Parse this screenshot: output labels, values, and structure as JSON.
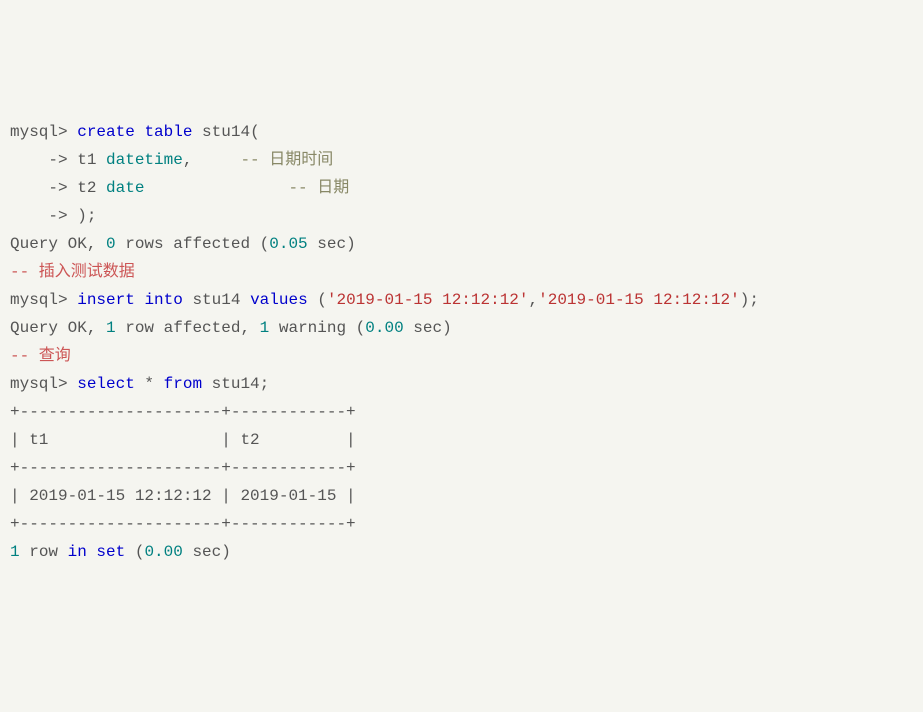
{
  "lines": {
    "l1_prompt": "mysql> ",
    "l1_kw1": "create",
    "l1_kw2": "table",
    "l1_id": " stu14(",
    "l2_prefix": "    -> t1 ",
    "l2_type": "datetime",
    "l2_comma": ",     ",
    "l2_comment": "-- 日期时间",
    "l3_prefix": "    -> t2 ",
    "l3_type": "date",
    "l3_space": "               ",
    "l3_comment": "-- 日期",
    "l4": "    -> );",
    "l5_a": "Query OK, ",
    "l5_n1": "0",
    "l5_b": " rows affected (",
    "l5_n2": "0.05",
    "l5_c": " sec)",
    "l6": "-- 插入测试数据",
    "l7_prompt": "mysql> ",
    "l7_kw1": "insert",
    "l7_kw2": "into",
    "l7_id": " stu14 ",
    "l7_kw3": "values",
    "l7_open": " (",
    "l7_s1": "'2019-01-15 12:12:12'",
    "l7_comma": ",",
    "l7_s2": "'2019-01-15 12:12:12'",
    "l7_close": ");",
    "l8_a": "Query OK, ",
    "l8_n1": "1",
    "l8_b": " row affected, ",
    "l8_n2": "1",
    "l8_c": " warning (",
    "l8_n3": "0.00",
    "l8_d": " sec)",
    "l9": "-- 查询",
    "l10_prompt": "mysql> ",
    "l10_kw1": "select",
    "l10_star": " * ",
    "l10_kw2": "from",
    "l10_id": " stu14;",
    "l11": "+---------------------+------------+",
    "l12": "| t1                  | t2         |",
    "l13": "+---------------------+------------+",
    "l14": "| 2019-01-15 12:12:12 | 2019-01-15 |",
    "l15": "+---------------------+------------+",
    "l16_n1": "1",
    "l16_a": " row ",
    "l16_kw": "in set",
    "l16_b": " (",
    "l16_n2": "0.00",
    "l16_c": " sec)"
  }
}
